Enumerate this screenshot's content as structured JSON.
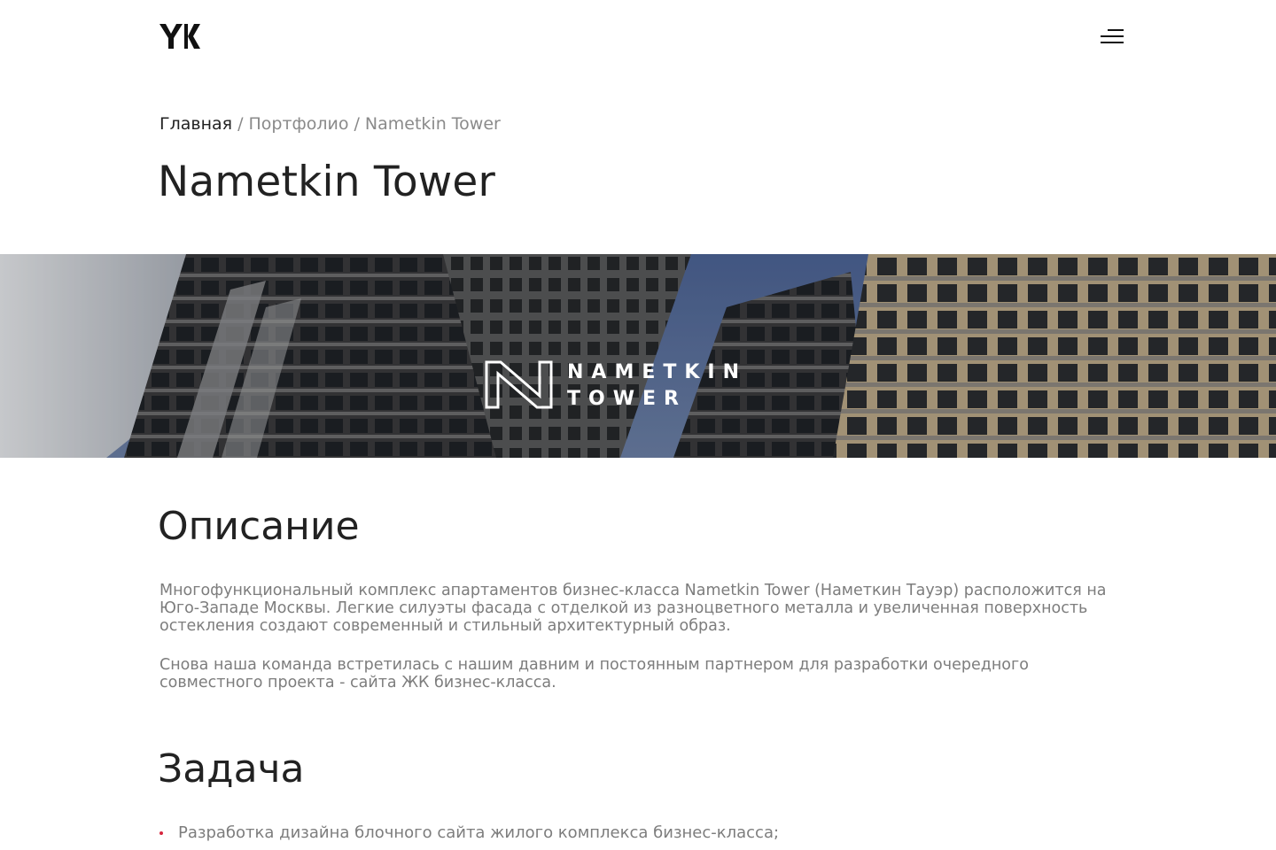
{
  "header": {
    "logo_text": "YK",
    "menu_icon": "hamburger-menu-icon"
  },
  "breadcrumb": {
    "home": "Главная",
    "separator": "/",
    "portfolio": "Портфолио",
    "current": "Nametkin Tower"
  },
  "page_title": "Nametkin Tower",
  "hero": {
    "logo_line1": "NAMETKIN",
    "logo_line2": "TOWER"
  },
  "description": {
    "title": "Описание",
    "paragraph1": "Многофункциональный комплекс апартаментов бизнес-класса Nametkin Tower (Наметкин Тауэр) расположится на Юго-Западе Москвы. Легкие силуэты фасада с отделкой из разноцветного металла и увеличенная поверхность остекления создают современный и стильный архитектурный образ.",
    "paragraph2": "Снова наша команда встретилась с нашим давним и постоянным партнером для разработки очередного совместного проекта - сайта ЖК бизнес-класса."
  },
  "task": {
    "title": "Задача",
    "items": [
      "Разработка дизайна блочного сайта жилого комплекса бизнес-класса;"
    ]
  },
  "colors": {
    "text_dark": "#222222",
    "text_muted": "#7d7d7d",
    "bullet_accent": "#d6263e"
  }
}
